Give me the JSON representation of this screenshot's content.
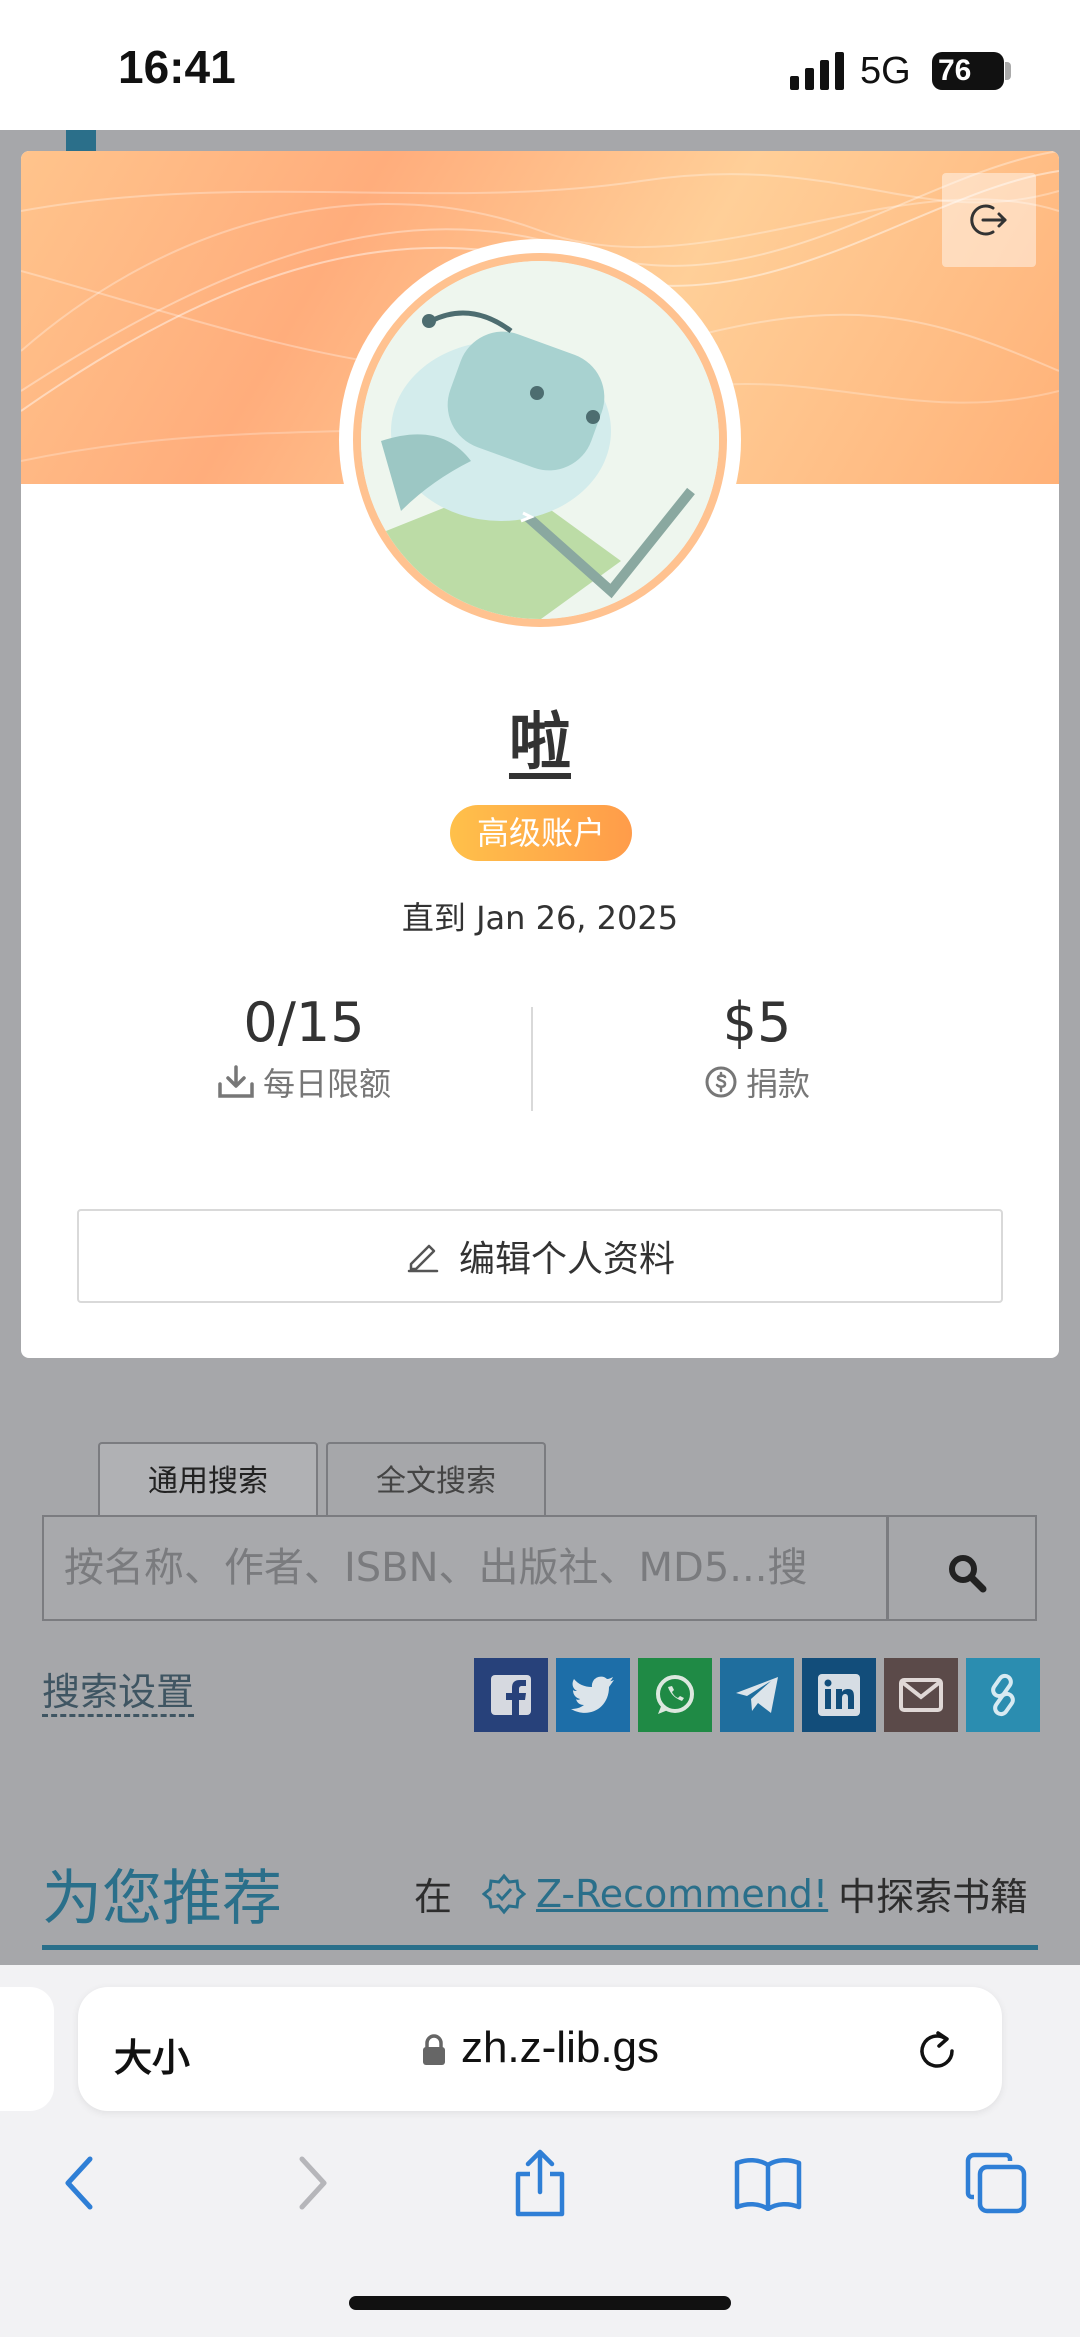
{
  "status": {
    "time": "16:41",
    "network": "5G",
    "battery": "76"
  },
  "profile": {
    "username": "啦",
    "badge": "高级账户",
    "until": "直到 Jan 26, 2025",
    "daily_quota_value": "0/15",
    "daily_quota_label": "每日限额",
    "donation_value": "$5",
    "donation_label": "捐款",
    "edit_label": "编辑个人资料"
  },
  "search": {
    "tabs": [
      "通用搜索",
      "全文搜索"
    ],
    "placeholder": "按名称、作者、ISBN、出版社、MD5...搜",
    "settings_label": "搜索设置"
  },
  "share": [
    {
      "icon": "facebook-icon",
      "color": "#27417a"
    },
    {
      "icon": "twitter-icon",
      "color": "#1d6ea8"
    },
    {
      "icon": "whatsapp-icon",
      "color": "#1f8a45"
    },
    {
      "icon": "telegram-icon",
      "color": "#1f6e9e"
    },
    {
      "icon": "linkedin-icon",
      "color": "#124d7a"
    },
    {
      "icon": "email-icon",
      "color": "#5b4a49"
    },
    {
      "icon": "link-icon",
      "color": "#2b8db0"
    }
  ],
  "recommend": {
    "title": "为您推荐",
    "prefix": "在",
    "link": "Z-Recommend!",
    "suffix": "中探索书籍"
  },
  "browser": {
    "text_size": "大小",
    "url": "zh.z-lib.gs"
  },
  "colors": {
    "accent": "#2a6f8a",
    "badge": "#ffb04a",
    "avatar_ring": "#ffc290"
  }
}
